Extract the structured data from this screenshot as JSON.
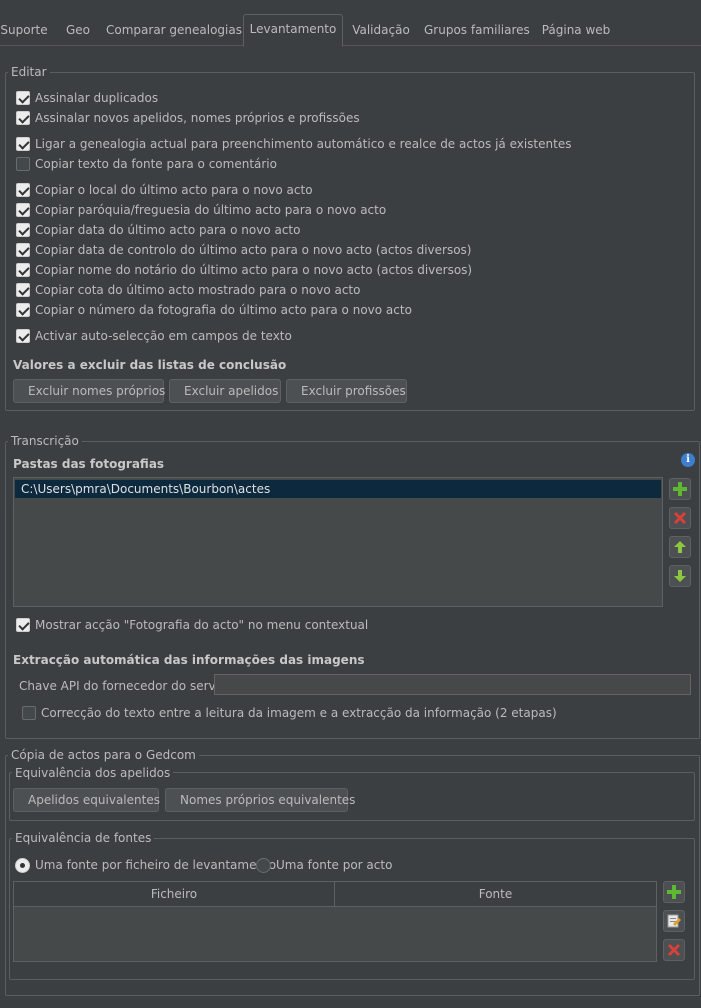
{
  "tabs": [
    "Suporte",
    "Geo",
    "Comparar genealogias",
    "Levantamento",
    "Validação",
    "Grupos familiares",
    "Página web"
  ],
  "active_tab": "Levantamento",
  "editar": {
    "title": "Editar",
    "options": [
      {
        "label": "Assinalar duplicados",
        "checked": true
      },
      {
        "label": "Assinalar novos apelidos, nomes próprios e profissões",
        "checked": true
      },
      {
        "label": "Ligar a genealogia actual para preenchimento automático e realce de actos já existentes",
        "checked": true
      },
      {
        "label": "Copiar texto da fonte para o comentário",
        "checked": false
      },
      {
        "label": "Copiar o local do último acto para o novo acto",
        "checked": true
      },
      {
        "label": "Copiar paróquia/freguesia do último acto para o novo acto",
        "checked": true
      },
      {
        "label": "Copiar data do último acto para o novo acto",
        "checked": true
      },
      {
        "label": "Copiar data de controlo do último acto para o novo acto (actos diversos)",
        "checked": true
      },
      {
        "label": "Copiar nome do notário do último acto para o novo acto (actos diversos)",
        "checked": true
      },
      {
        "label": "Copiar cota do último acto mostrado para o novo acto",
        "checked": true
      },
      {
        "label": "Copiar o número da fotografia do último acto para o novo acto",
        "checked": true
      },
      {
        "label": "Activar auto-selecção em campos de texto",
        "checked": true
      }
    ],
    "exclude_heading": "Valores a excluir das listas de conclusão",
    "buttons": [
      "Excluir nomes próprios",
      "Excluir apelidos",
      "Excluir profissões"
    ]
  },
  "transcricao": {
    "title": "Transcrição",
    "folders_heading": "Pastas das fotografias",
    "folders": [
      "C:\\Users\\pmra\\Documents\\Bourbon\\actes"
    ],
    "show_action": {
      "label": "Mostrar acção \"Fotografia do acto\" no menu contextual",
      "checked": true
    },
    "extract_heading": "Extracção automática das informações das imagens",
    "api_key_label": "Chave API do fornecedor do serviço",
    "api_key_value": "",
    "two_step": {
      "label": "Correcção do texto entre a leitura da imagem e a extracção da informação (2 etapas)",
      "checked": false
    }
  },
  "gedcom": {
    "title": "Cópia de actos para o Gedcom",
    "surnames": {
      "title": "Equivalência dos apelidos",
      "buttons": [
        "Apelidos equivalentes",
        "Nomes próprios equivalentes"
      ]
    },
    "sources": {
      "title": "Equivalência de fontes",
      "radio_options": [
        {
          "label": "Uma fonte por ficheiro de levantamento",
          "checked": true
        },
        {
          "label": "Uma fonte por acto",
          "checked": false
        }
      ],
      "columns": [
        "Ficheiro",
        "Fonte"
      ]
    }
  },
  "colors": {
    "background": "#3c3f41",
    "text": "#bbbbbb",
    "selection": "#0d293e",
    "add_green": "#5fb832",
    "delete_red": "#d9403a",
    "info_blue": "#3d7ecf"
  }
}
